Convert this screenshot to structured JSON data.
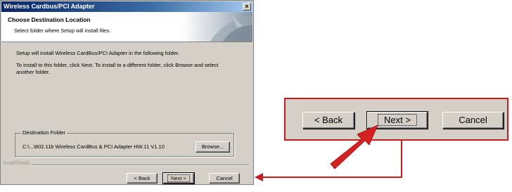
{
  "dialog": {
    "title": "Wireless Cardbus/PCI Adapter",
    "close_glyph": "×",
    "header": {
      "title": "Choose Destination Location",
      "subtitle": "Select folder where Setup will install files."
    },
    "body": {
      "line1": "Setup will install Wireless CardBus/PCI Adapter in the following folder.",
      "line2a": "To install to this folder, click Next. To install to a different folder, click Browse and select",
      "line2b": "another folder."
    },
    "destination": {
      "legend": "Destination Folder",
      "path": "C:\\...\\802.11b Wireless CardBus & PCI Adapter HW.11 V1.10",
      "browse_label": "Browse..."
    },
    "brand": "InstallShield",
    "buttons": {
      "back": "< Back",
      "next": "Next >",
      "cancel": "Cancel"
    }
  },
  "zoom": {
    "back": "< Back",
    "next": "Next >",
    "cancel": "Cancel"
  },
  "colors": {
    "annotation_red": "#c41e1e",
    "dialog_gray": "#d4d0c8",
    "titlebar_blue": "#0a246a"
  }
}
